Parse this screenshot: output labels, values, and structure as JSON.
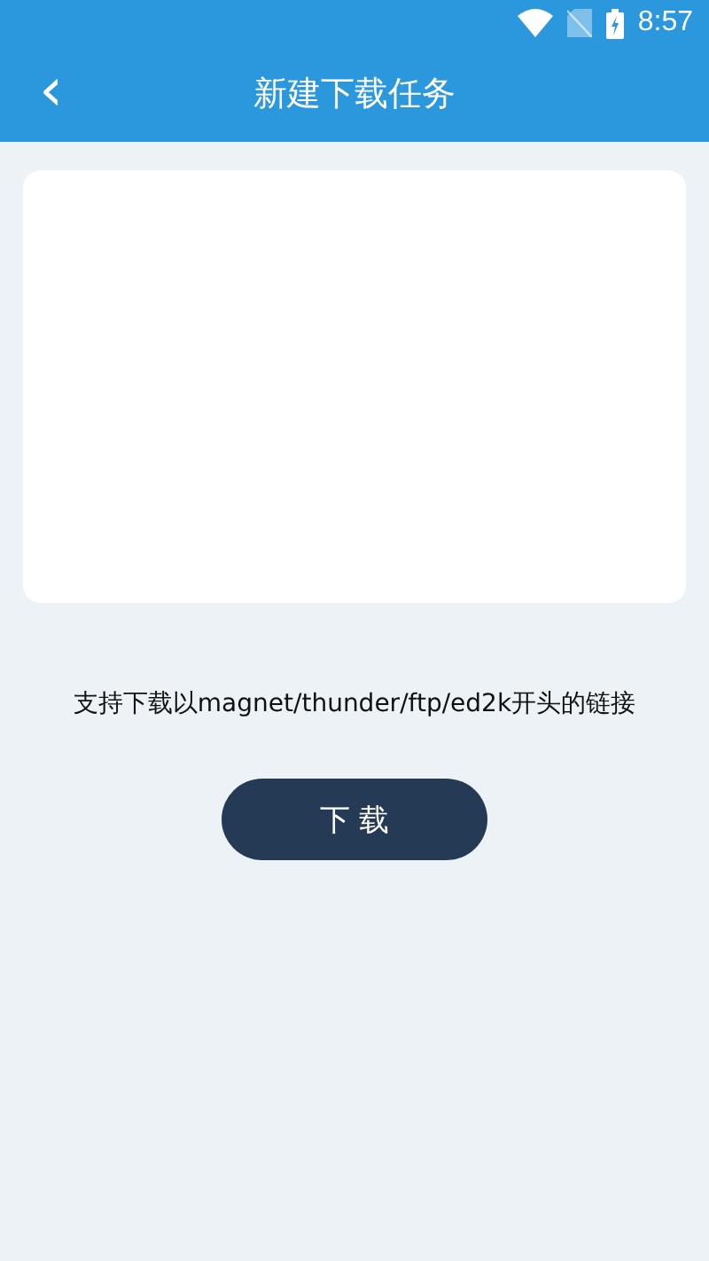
{
  "status_bar": {
    "time": "8:57"
  },
  "header": {
    "back_icon": "‹",
    "title": "新建下载任务"
  },
  "hint": "支持下载以magnet/thunder/ftp/ed2k开头的链接",
  "download_button": {
    "label": "下 载"
  }
}
